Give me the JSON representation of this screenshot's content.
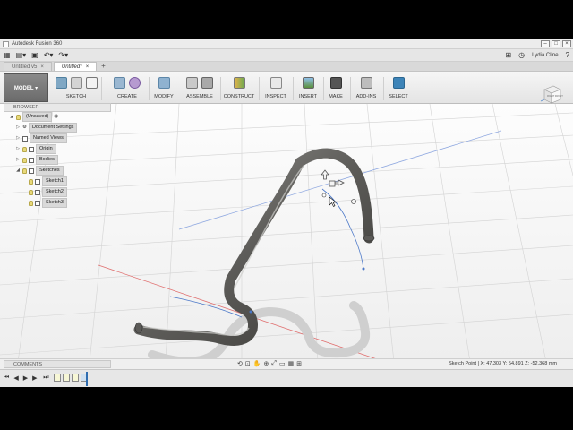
{
  "window": {
    "title": "Autodesk Fusion 360"
  },
  "quick_access": {
    "user_name": "Lydia Cline"
  },
  "tabs": [
    {
      "label": "Untitled v5",
      "active": false
    },
    {
      "label": "Untitled*",
      "active": true
    }
  ],
  "ribbon": {
    "workspace_label": "MODEL",
    "groups": [
      {
        "label": "SKETCH"
      },
      {
        "label": "CREATE"
      },
      {
        "label": "MODIFY"
      },
      {
        "label": "ASSEMBLE"
      },
      {
        "label": "CONSTRUCT"
      },
      {
        "label": "INSPECT"
      },
      {
        "label": "INSERT"
      },
      {
        "label": "MAKE"
      },
      {
        "label": "ADD-INS"
      },
      {
        "label": "SELECT"
      }
    ]
  },
  "viewcube": {
    "face_label": "RIGHT FRONT"
  },
  "browser": {
    "header": "BROWSER",
    "root": "(Unsaved)",
    "items": [
      {
        "label": "Document Settings"
      },
      {
        "label": "Named Views"
      },
      {
        "label": "Origin"
      },
      {
        "label": "Bodies"
      },
      {
        "label": "Sketches"
      },
      {
        "label": "Sketch1"
      },
      {
        "label": "Sketch2"
      },
      {
        "label": "Sketch3"
      }
    ]
  },
  "comments": {
    "header": "COMMENTS"
  },
  "status": {
    "coordinate_readout": "Sketch Point | X: 47.303 Y: 54.891 Z: -52.368 mm"
  },
  "colors": {
    "accent": "#3d84b8",
    "body_metal": "#6a6966"
  }
}
